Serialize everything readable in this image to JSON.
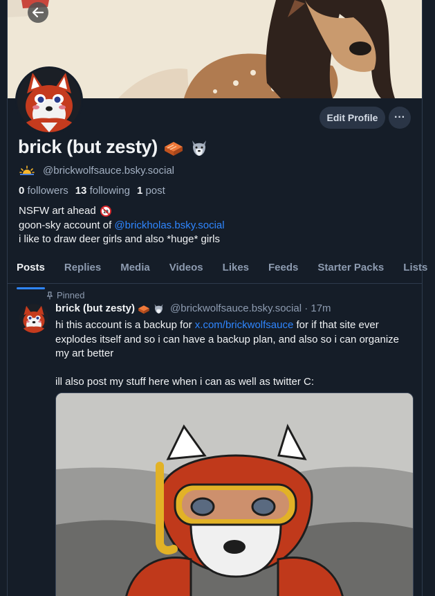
{
  "profile": {
    "display_name": "brick (but zesty)",
    "handle": "@brickwolfsauce.bsky.social",
    "stats": {
      "followers_count": "0",
      "followers_label": "followers",
      "following_count": "13",
      "following_label": "following",
      "posts_count": "1",
      "posts_label": "post"
    },
    "bio": {
      "line1": "NSFW art ahead",
      "line2_prefix": "goon-sky account of ",
      "line2_link": "@brickholas.bsky.social",
      "line3": "i like to draw deer girls and also *huge* girls"
    },
    "actions": {
      "edit_label": "Edit Profile",
      "more_label": "···"
    }
  },
  "tabs": [
    "Posts",
    "Replies",
    "Media",
    "Videos",
    "Likes",
    "Feeds",
    "Starter Packs",
    "Lists"
  ],
  "post": {
    "pinned_label": "Pinned",
    "author": "brick (but zesty)",
    "meta": "@brickwolfsauce.bsky.social · 17m",
    "text_prefix": "hi this account is a backup for ",
    "text_link": "x.com/brickwolfsauce",
    "text_rest": " for if that site ever explodes itself and so i can have a backup plan, and also so i can organize my art better",
    "text_line2": "ill also post my stuff here when i can as well as twitter C:"
  },
  "icons": {
    "back": "arrow-left-icon",
    "brick": "brick-emoji-icon",
    "wolf": "wolf-emoji-icon",
    "sunrise": "sunrise-icon",
    "no18": "no-under-18-icon",
    "pin": "pin-icon"
  },
  "colors": {
    "accent": "#2f86ff",
    "background": "#151d28",
    "muted": "#8d9bb0"
  }
}
